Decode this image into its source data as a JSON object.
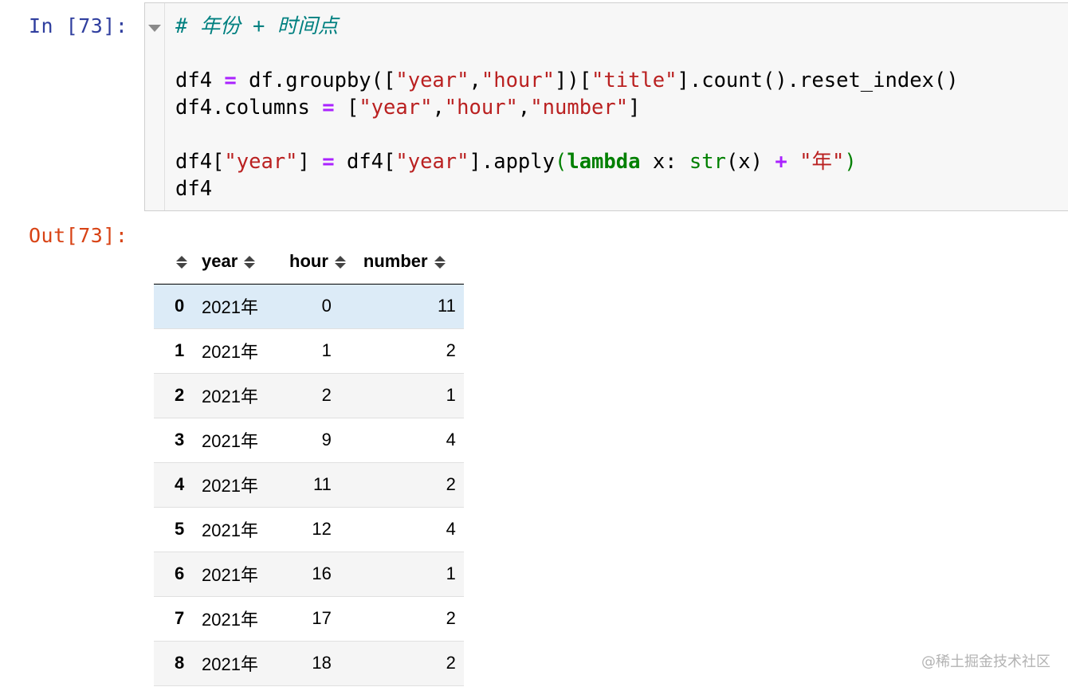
{
  "cell": {
    "in_prompt": "In [73]:",
    "out_prompt": "Out[73]:",
    "code_lines": [
      [
        {
          "t": "# 年份 + 时间点",
          "c": "c-com"
        }
      ],
      [],
      [
        {
          "t": "df4 "
        },
        {
          "t": "=",
          "c": "c-op"
        },
        {
          "t": " df.groupby(["
        },
        {
          "t": "\"year\"",
          "c": "c-str"
        },
        {
          "t": ","
        },
        {
          "t": "\"hour\"",
          "c": "c-str"
        },
        {
          "t": "])["
        },
        {
          "t": "\"title\"",
          "c": "c-str"
        },
        {
          "t": "].count().reset_index()"
        }
      ],
      [
        {
          "t": "df4.columns "
        },
        {
          "t": "=",
          "c": "c-op"
        },
        {
          "t": " ["
        },
        {
          "t": "\"year\"",
          "c": "c-str"
        },
        {
          "t": ","
        },
        {
          "t": "\"hour\"",
          "c": "c-str"
        },
        {
          "t": ","
        },
        {
          "t": "\"number\"",
          "c": "c-str"
        },
        {
          "t": "]"
        }
      ],
      [],
      [
        {
          "t": "df4["
        },
        {
          "t": "\"year\"",
          "c": "c-str"
        },
        {
          "t": "] "
        },
        {
          "t": "=",
          "c": "c-op"
        },
        {
          "t": " df4["
        },
        {
          "t": "\"year\"",
          "c": "c-str"
        },
        {
          "t": "].apply"
        },
        {
          "t": "(",
          "c": "c-bi"
        },
        {
          "t": "lambda",
          "c": "c-kw"
        },
        {
          "t": " x: "
        },
        {
          "t": "str",
          "c": "c-bi"
        },
        {
          "t": "(x) "
        },
        {
          "t": "+",
          "c": "c-op"
        },
        {
          "t": " "
        },
        {
          "t": "\"年\"",
          "c": "c-str"
        },
        {
          "t": ")",
          "c": "c-bi"
        }
      ],
      [
        {
          "t": "df4"
        }
      ]
    ]
  },
  "table": {
    "columns": [
      "year",
      "hour",
      "number"
    ],
    "rows": [
      {
        "index": "0",
        "year": "2021年",
        "hour": "0",
        "number": "11"
      },
      {
        "index": "1",
        "year": "2021年",
        "hour": "1",
        "number": "2"
      },
      {
        "index": "2",
        "year": "2021年",
        "hour": "2",
        "number": "1"
      },
      {
        "index": "3",
        "year": "2021年",
        "hour": "9",
        "number": "4"
      },
      {
        "index": "4",
        "year": "2021年",
        "hour": "11",
        "number": "2"
      },
      {
        "index": "5",
        "year": "2021年",
        "hour": "12",
        "number": "4"
      },
      {
        "index": "6",
        "year": "2021年",
        "hour": "16",
        "number": "1"
      },
      {
        "index": "7",
        "year": "2021年",
        "hour": "17",
        "number": "2"
      },
      {
        "index": "8",
        "year": "2021年",
        "hour": "18",
        "number": "2"
      }
    ],
    "selected_row": 0
  },
  "watermark": "@稀土掘金技术社区",
  "icons": {
    "collapse": "collapse-triangle-icon",
    "sort": "sort-arrows-icon"
  }
}
